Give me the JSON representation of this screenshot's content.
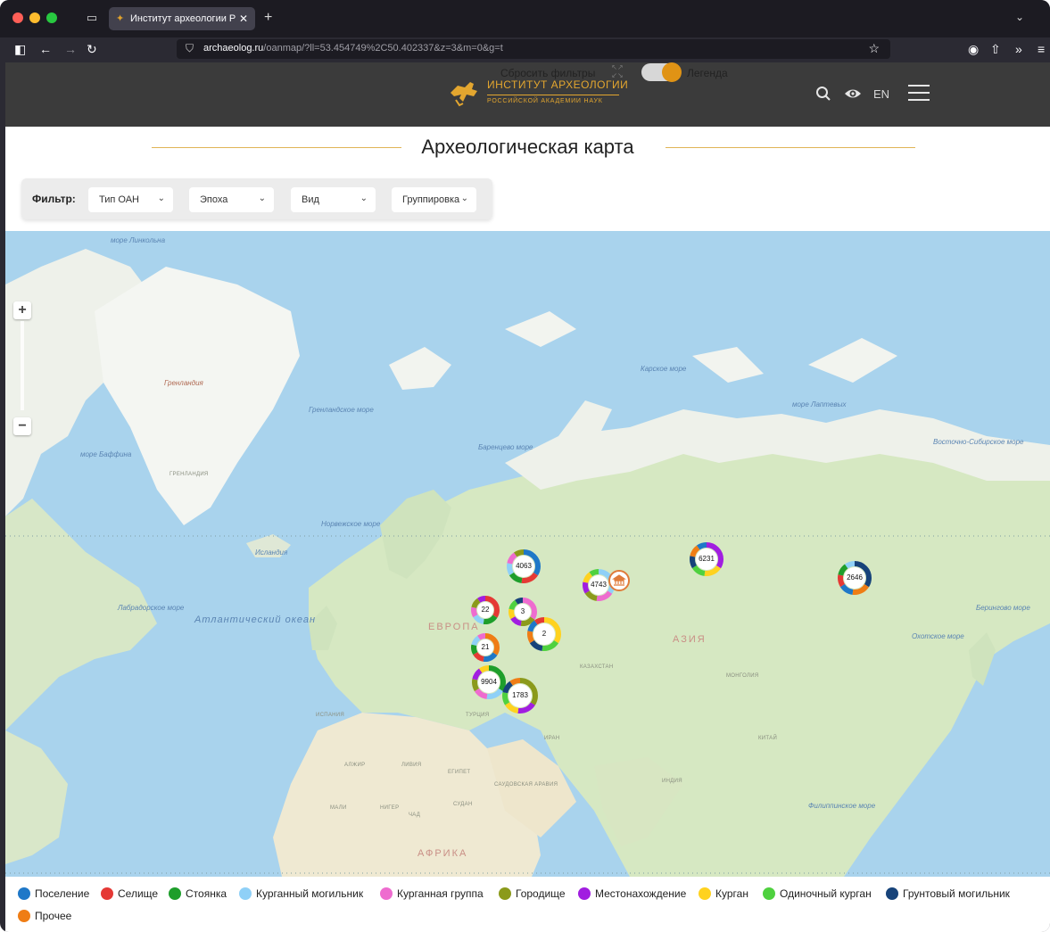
{
  "browser": {
    "tab_title": "Институт археологии Российс",
    "url_domain": "archaeolog.ru",
    "url_path": "/oanmap/?ll=53.454749%2C50.402337&z=3&m=0&g=t"
  },
  "header": {
    "logo_line1": "ИНСТИТУТ АРХЕОЛОГИИ",
    "logo_line2": "РОССИЙСКОЙ АКАДЕМИИ НАУК",
    "lang": "EN"
  },
  "page": {
    "title": "Археологическая карта"
  },
  "filter": {
    "label": "Фильтр:",
    "selects": [
      "Тип ОАН",
      "Эпоха",
      "Вид",
      "Группировка"
    ],
    "reset": "Сбросить фильтры",
    "legend_toggle": "Легенда",
    "legend_on": true
  },
  "map_labels": {
    "seas": [
      "море Линкольна",
      "Гренландия",
      "Гренландское море",
      "море Баффина",
      "Баренцево море",
      "Карское море",
      "море Лаптевых",
      "Восточно-Сибирское море",
      "Норвежское море",
      "Исландия",
      "Лабрадорское море",
      "Атлантический океан",
      "Берингово море",
      "Охотское море",
      "Филиппинское море"
    ],
    "land": [
      "ГРЕНЛАНДИЯ",
      "ЕВРОПА",
      "АЗИЯ",
      "АФРИКА",
      "КАЗАХСТАН",
      "МОНГОЛИЯ",
      "ИСПАНИЯ",
      "ТУРЦИЯ",
      "АЛЖИР",
      "ЛИВИЯ",
      "ЕГИПЕТ",
      "САУДОВСКАЯ АРАВИЯ",
      "МАЛИ",
      "НИГЕР",
      "ЧАД",
      "СУДАН",
      "ИРАН",
      "ИНДИЯ",
      "КИТАЙ"
    ]
  },
  "clusters": [
    {
      "count": "4063"
    },
    {
      "count": "4743"
    },
    {
      "count": "6231"
    },
    {
      "count": "2646"
    },
    {
      "count": "22"
    },
    {
      "count": "3"
    },
    {
      "count": "2"
    },
    {
      "count": "21"
    },
    {
      "count": "9904"
    },
    {
      "count": "1783"
    }
  ],
  "legend": [
    {
      "label": "Поселение",
      "color": "#1f78c8"
    },
    {
      "label": "Селище",
      "color": "#e53935"
    },
    {
      "label": "Стоянка",
      "color": "#1e9e2b"
    },
    {
      "label": "Курганный могильник",
      "color": "#8fd0f7"
    },
    {
      "label": "Курганная группа",
      "color": "#ee6ccf"
    },
    {
      "label": "Городище",
      "color": "#8b9a1b"
    },
    {
      "label": "Местонахождение",
      "color": "#a11ee0"
    },
    {
      "label": "Курган",
      "color": "#ffd21f"
    },
    {
      "label": "Одиночный курган",
      "color": "#4fd13f"
    },
    {
      "label": "Грунтовый могильник",
      "color": "#17437a"
    },
    {
      "label": "Прочее",
      "color": "#ef7d15"
    }
  ]
}
